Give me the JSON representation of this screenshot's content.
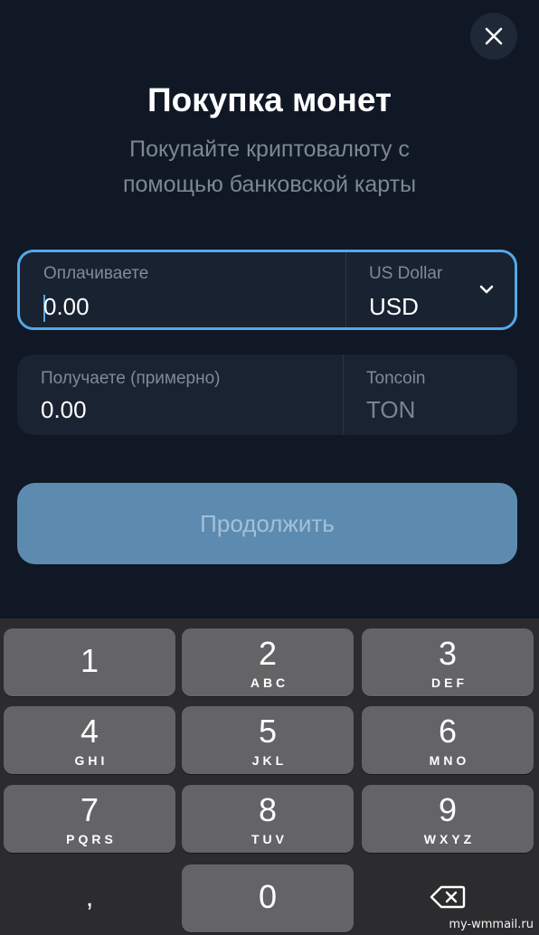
{
  "header": {
    "title": "Покупка монет",
    "subtitle_line1": "Покупайте криптовалюту с",
    "subtitle_line2": "помощью банковской карты"
  },
  "pay_field": {
    "label": "Оплачиваете",
    "value": "0.00",
    "currency_name": "US Dollar",
    "currency_code": "USD"
  },
  "receive_field": {
    "label": "Получаете (примерно)",
    "value": "0.00",
    "currency_name": "Toncoin",
    "currency_code": "TON"
  },
  "continue_button": {
    "label": "Продолжить"
  },
  "keyboard": {
    "keys": [
      {
        "num": "1",
        "letters": ""
      },
      {
        "num": "2",
        "letters": "ABC"
      },
      {
        "num": "3",
        "letters": "DEF"
      },
      {
        "num": "4",
        "letters": "GHI"
      },
      {
        "num": "5",
        "letters": "JKL"
      },
      {
        "num": "6",
        "letters": "MNO"
      },
      {
        "num": "7",
        "letters": "PQRS"
      },
      {
        "num": "8",
        "letters": "TUV"
      },
      {
        "num": "9",
        "letters": "WXYZ"
      },
      {
        "num": "0",
        "letters": ""
      }
    ],
    "decimal_key": ",",
    "backspace_icon": "backspace-icon"
  },
  "watermark": "my-wmmail.ru",
  "colors": {
    "background": "#101826",
    "field_bg": "#1a2331",
    "active_border": "#52a9e7",
    "button_bg": "#5d8bb0",
    "keyboard_bg": "#2c2c2e",
    "key_bg": "#646467"
  }
}
